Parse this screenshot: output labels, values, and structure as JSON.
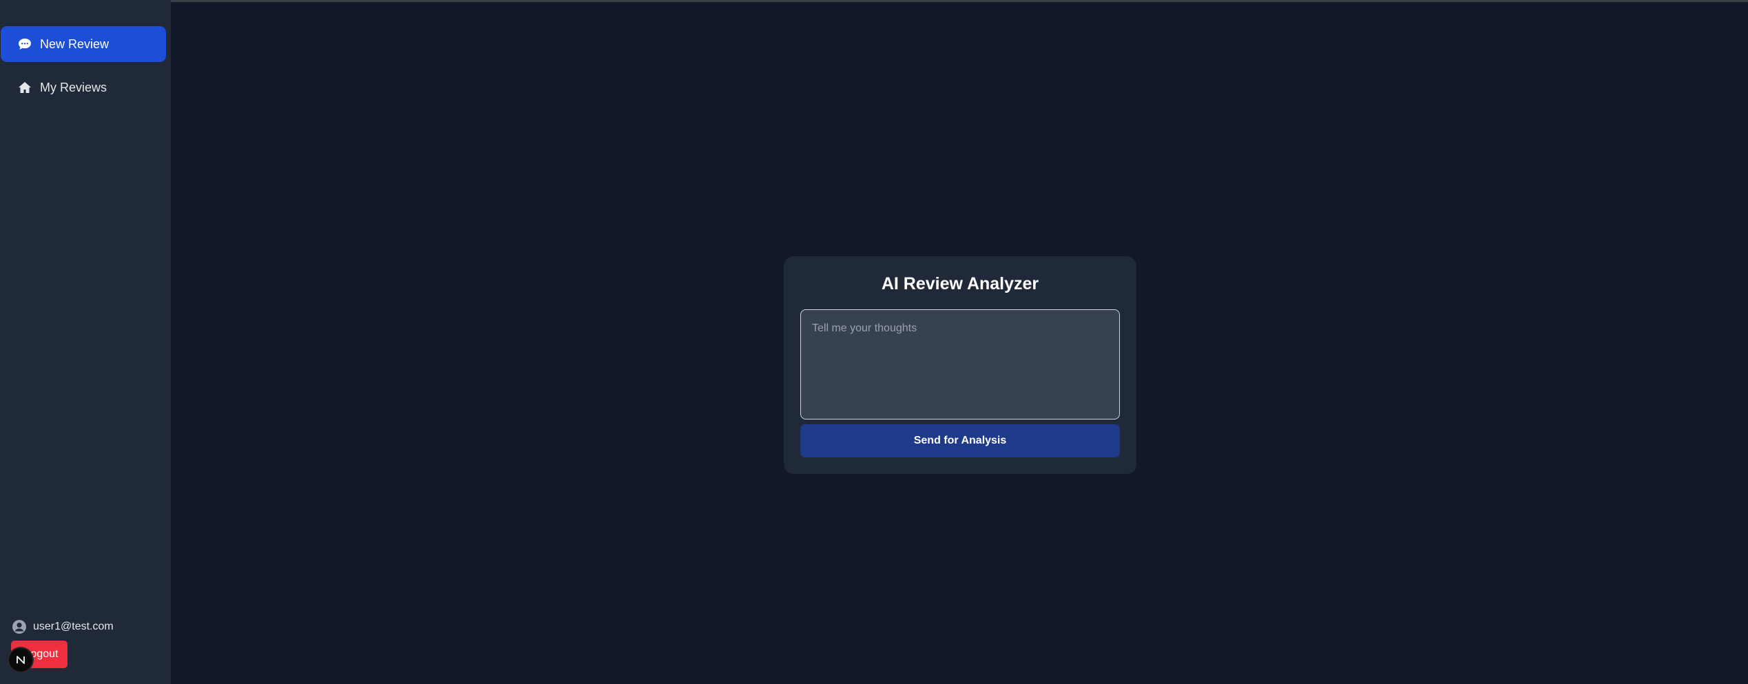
{
  "sidebar": {
    "items": [
      {
        "label": "New Review",
        "icon": "chat-bubble-icon",
        "active": true
      },
      {
        "label": "My Reviews",
        "icon": "home-icon",
        "active": false
      }
    ],
    "user_email": "user1@test.com",
    "logout_label": "Logout",
    "badge_letter": "N"
  },
  "main": {
    "title": "AI Review Analyzer",
    "review_placeholder": "Tell me your thoughts",
    "review_value": "",
    "send_label": "Send for Analysis"
  },
  "colors": {
    "page_bg": "#111827",
    "sidebar_bg": "#1f2937",
    "accent": "#1d4ed8",
    "send_button": "#1e3a8a",
    "logout": "#ef2f3f"
  }
}
